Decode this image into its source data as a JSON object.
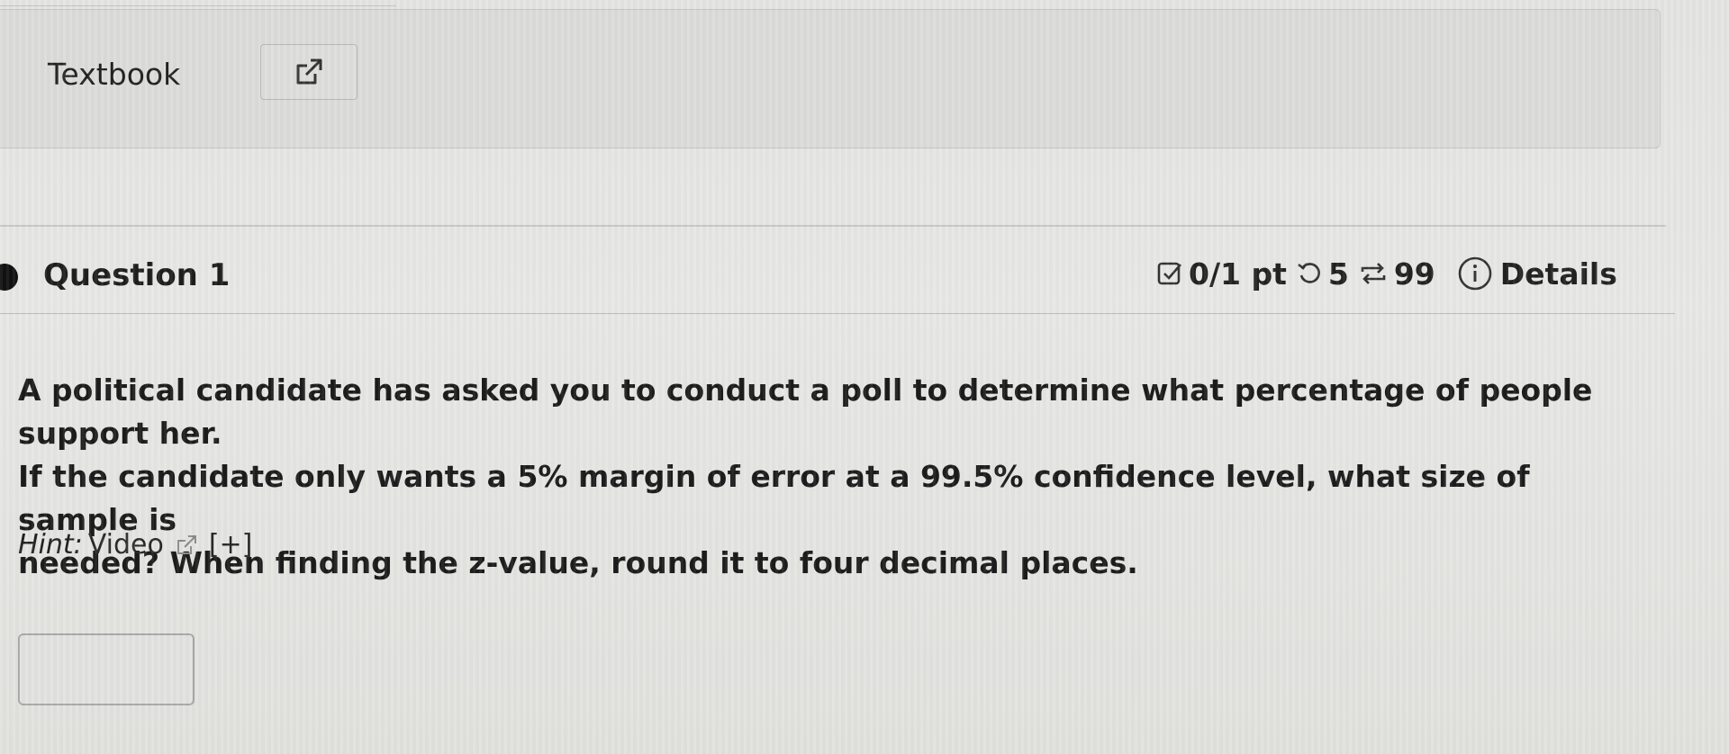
{
  "textbook": {
    "label": "Textbook",
    "link_icon": "external-link-icon"
  },
  "question": {
    "title": "Question 1",
    "points": "0/1 pt",
    "retries": "5",
    "submissions": "99",
    "details_label": "Details",
    "text_lines": [
      "A political candidate has asked you to conduct a poll to determine what percentage of people support her.",
      "If the candidate only wants a 5% margin of error at a 99.5% confidence level, what size of sample is",
      "needed? When finding the z-value, round it to four decimal places."
    ],
    "hint": {
      "label": "Hint:",
      "video_label": "Video",
      "expand_label": "[+]"
    },
    "answer": {
      "value": "",
      "placeholder": ""
    }
  },
  "icons": {
    "points": "checkbox-edit-icon",
    "retries": "undo-icon",
    "submissions": "repeat-icon",
    "details": "info-icon",
    "hint_video": "external-link-icon"
  }
}
